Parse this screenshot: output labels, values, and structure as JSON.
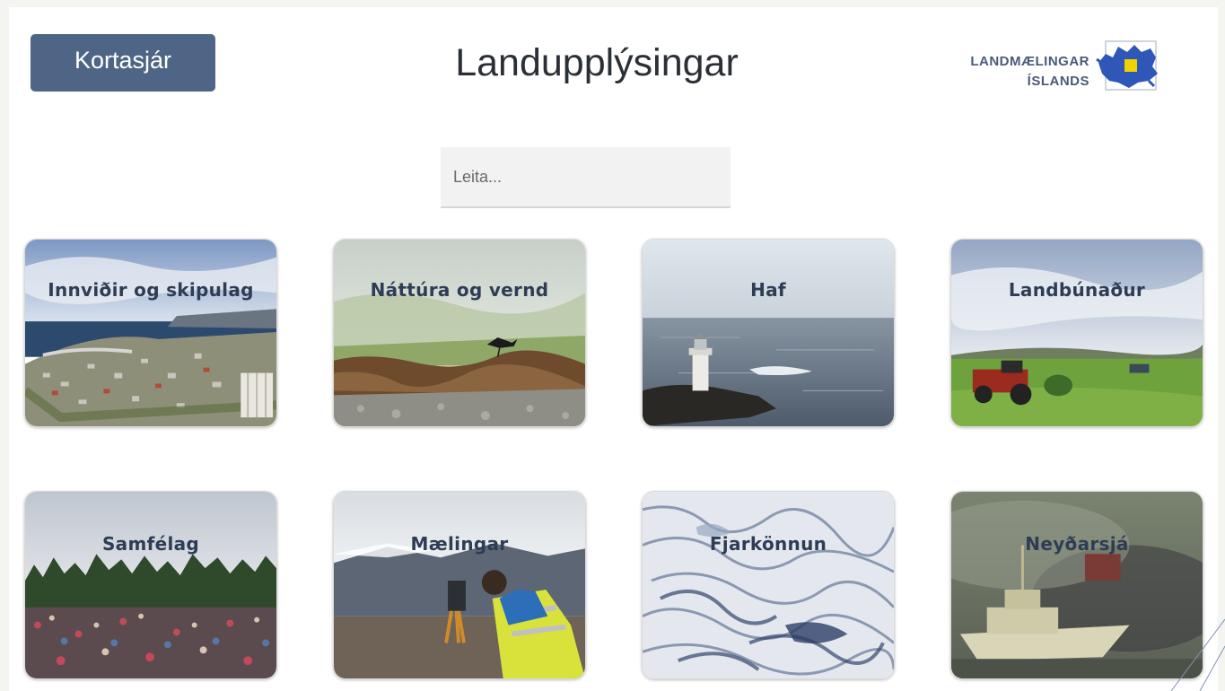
{
  "header": {
    "map_viewer_button": "Kortasjár",
    "page_title": "Landupplýsingar",
    "logo": {
      "line1": "LANDMÆLINGAR",
      "line2": "ÍSLANDS"
    }
  },
  "search": {
    "placeholder": "Leita..."
  },
  "categories": [
    {
      "label": "Innviðir og skipulag"
    },
    {
      "label": "Náttúra og vernd"
    },
    {
      "label": "Haf"
    },
    {
      "label": "Landbúnaður"
    },
    {
      "label": "Samfélag"
    },
    {
      "label": "Mælingar"
    },
    {
      "label": "Fjarkönnun"
    },
    {
      "label": "Neyðarsjá"
    }
  ],
  "colors": {
    "accent": "#4f6586",
    "label_text": "#2e3d55"
  }
}
